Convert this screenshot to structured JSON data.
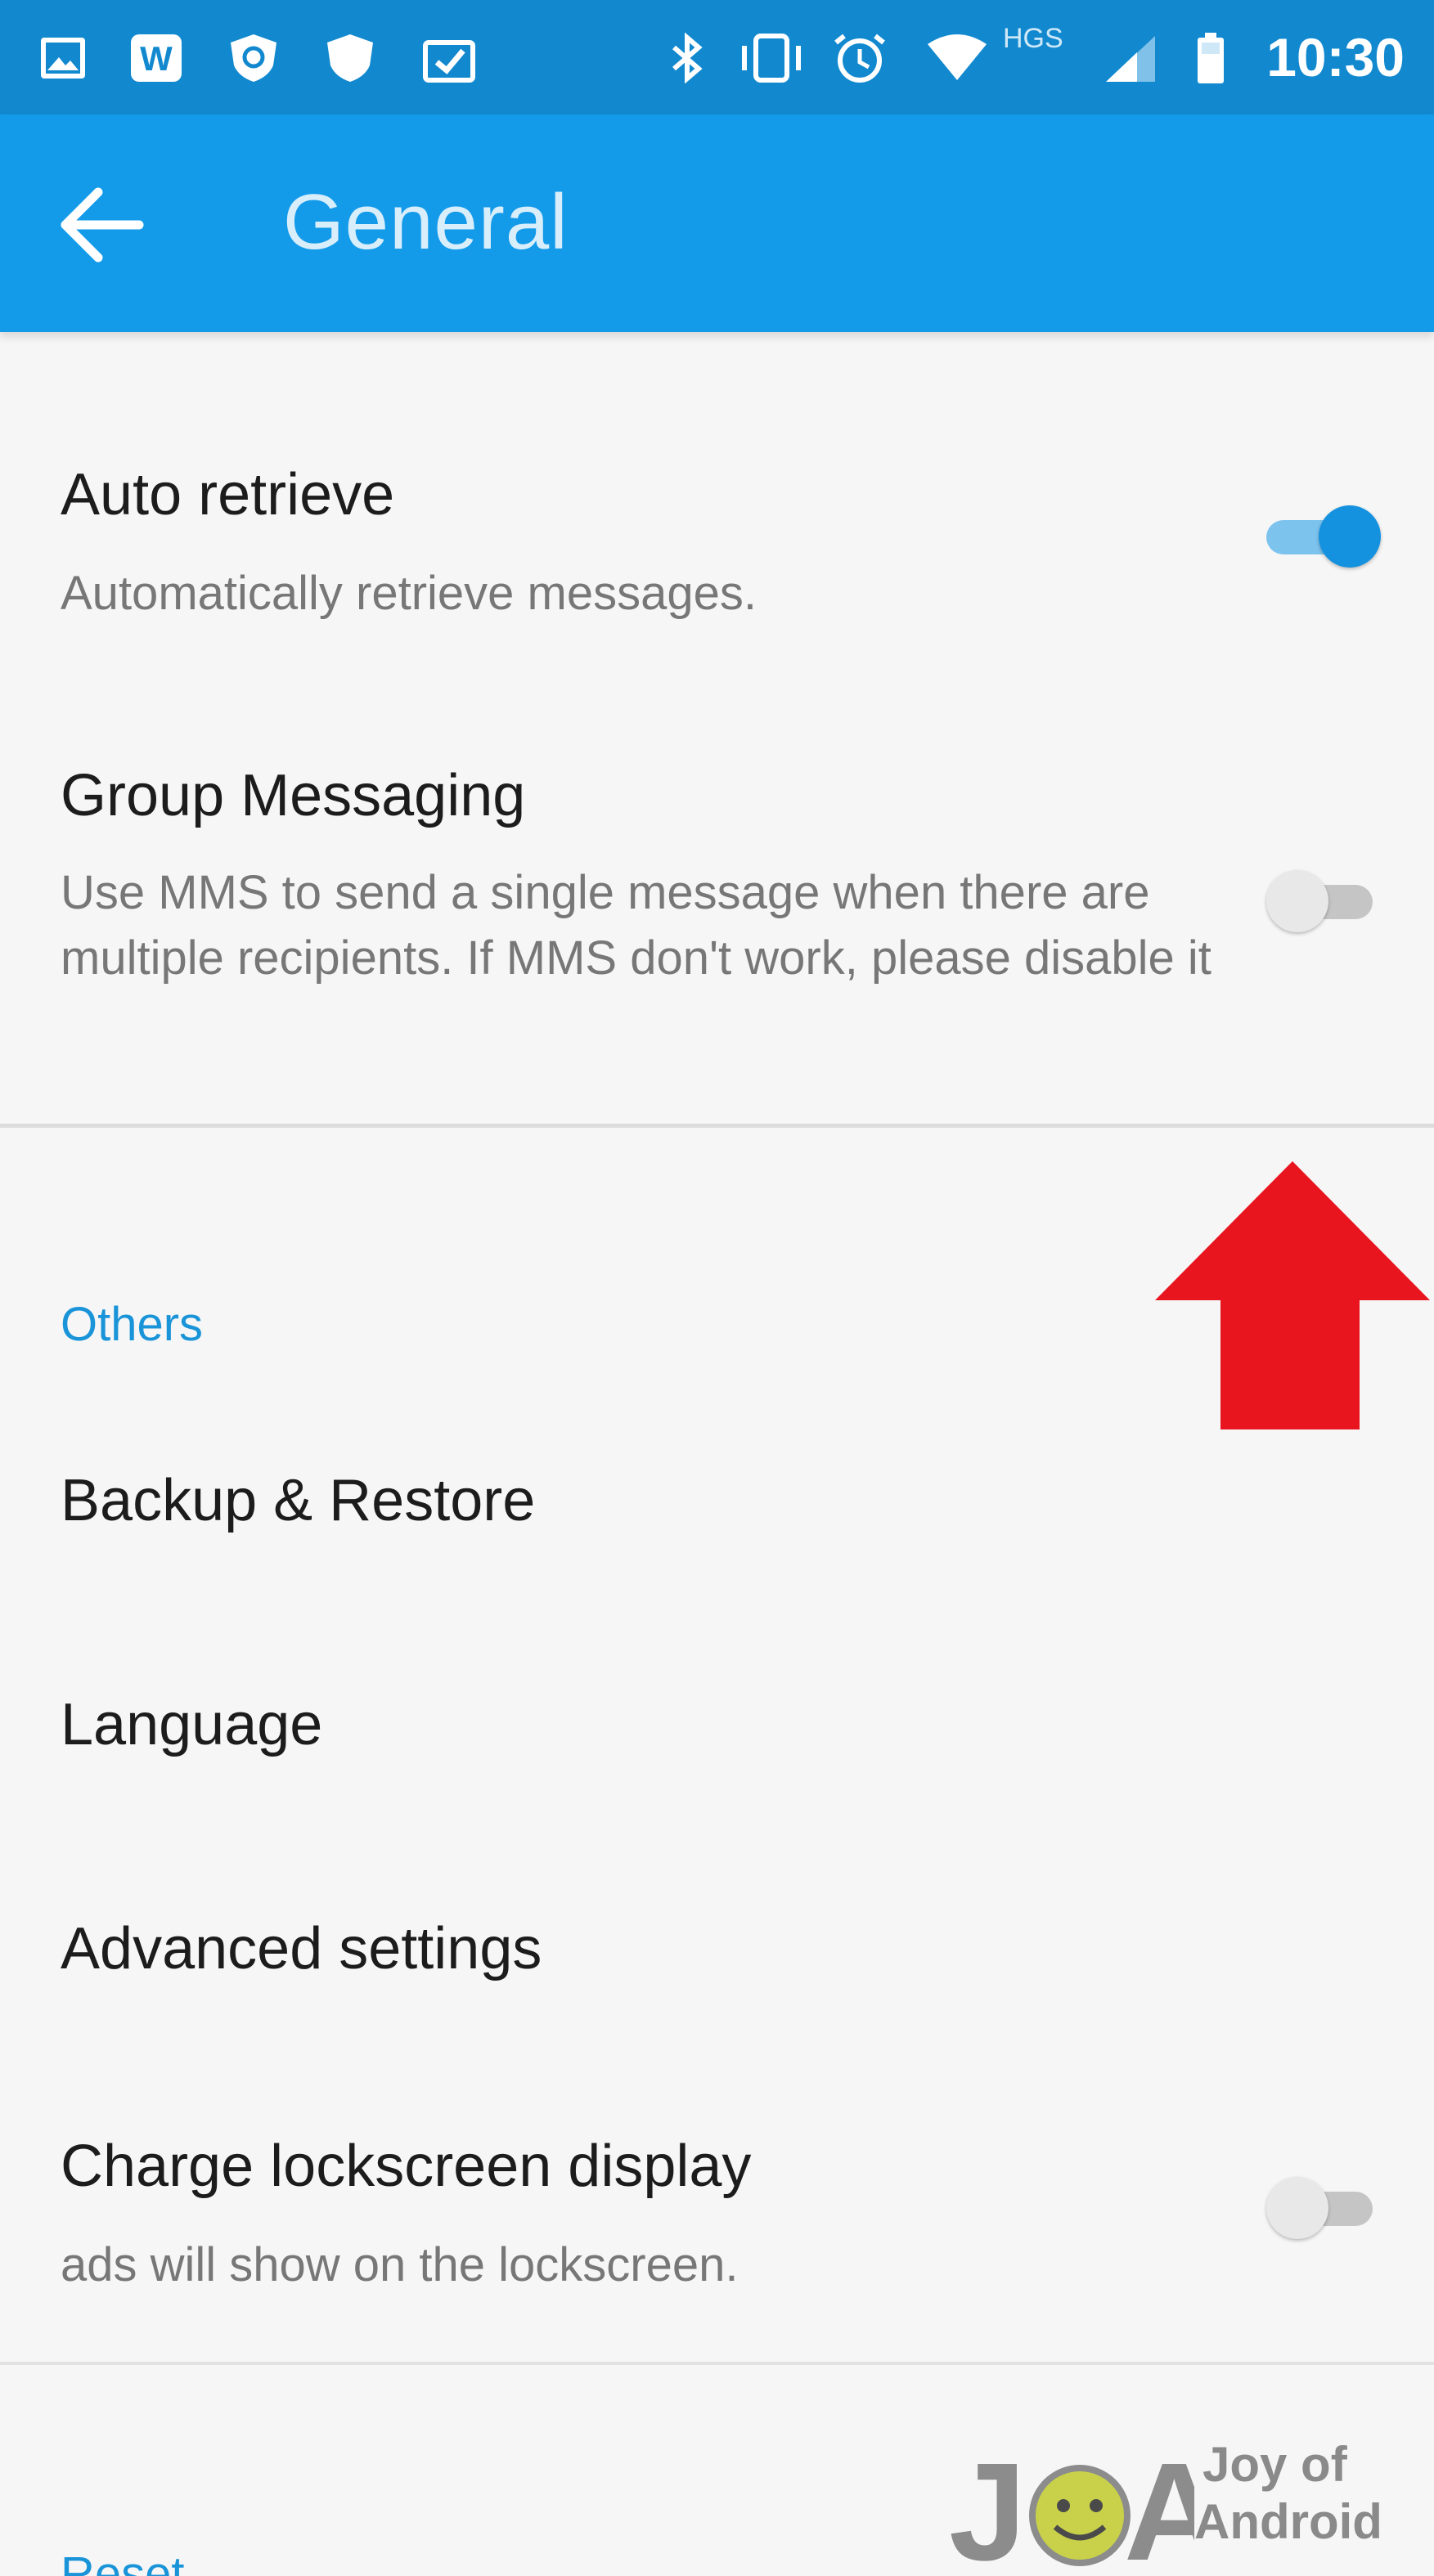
{
  "status_bar": {
    "time": "10:30",
    "network_label": "HGS",
    "icons": [
      "gallery-icon",
      "word-app-icon",
      "vpn-shield-icon",
      "shield-icon",
      "clipboard-check-icon",
      "bluetooth-icon",
      "vibrate-icon",
      "alarm-icon",
      "wifi-icon",
      "signal-icon",
      "battery-icon"
    ]
  },
  "toolbar": {
    "title": "General",
    "back_icon": "arrow-left-icon",
    "background_color": "#139bea"
  },
  "general": {
    "auto_retrieve": {
      "title": "Auto retrieve",
      "subtitle": "Automatically retrieve messages.",
      "enabled": true
    },
    "group_messaging": {
      "title": "Group Messaging",
      "subtitle": "Use MMS to send a single message when there are multiple recipients. If MMS don't work, please disable it",
      "enabled": false
    }
  },
  "others": {
    "header": "Others",
    "items": [
      {
        "label": "Backup & Restore"
      },
      {
        "label": "Language"
      },
      {
        "label": "Advanced settings"
      }
    ],
    "charge_lockscreen": {
      "title": "Charge lockscreen display",
      "subtitle": "ads will show on the lockscreen.",
      "enabled": false
    }
  },
  "reset": {
    "header": "Reset"
  },
  "annotation": {
    "arrow_color": "#e8141e",
    "arrow_icon": "red-up-arrow-icon"
  },
  "watermark": {
    "line1": "Joy of",
    "line2": "Android"
  }
}
